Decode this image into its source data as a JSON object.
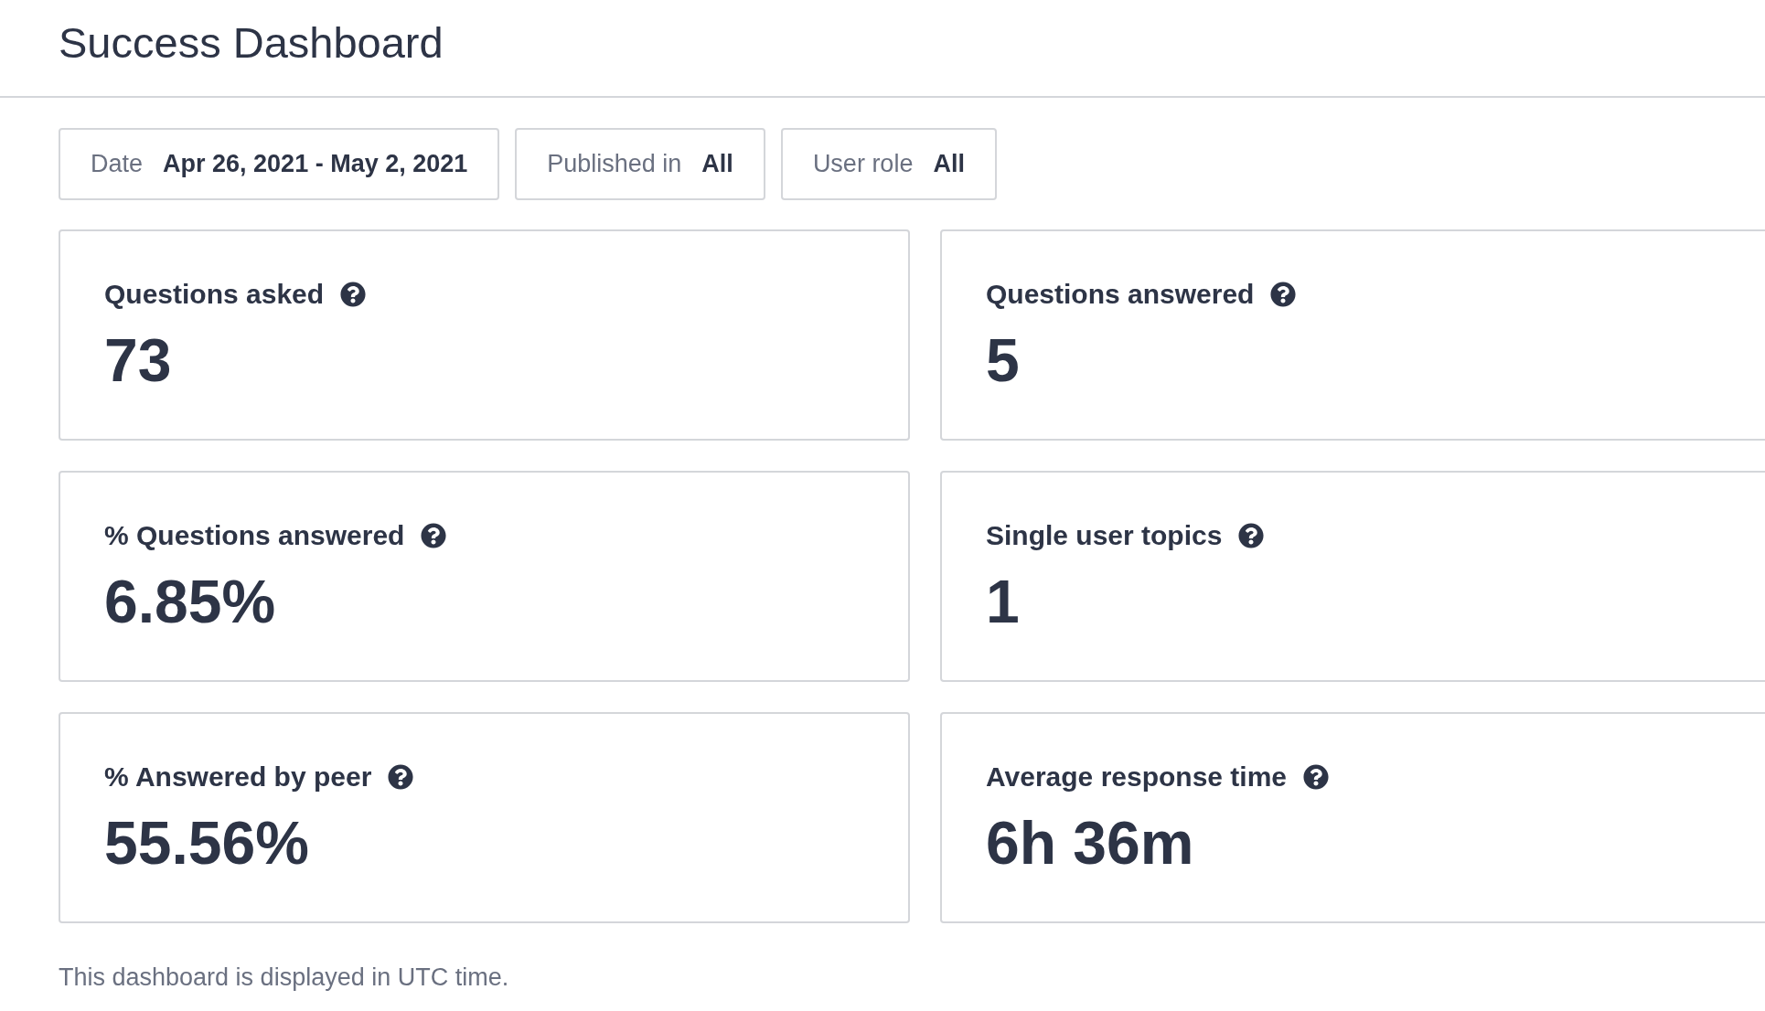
{
  "header": {
    "title": "Success Dashboard"
  },
  "filters": [
    {
      "label": "Date",
      "value": "Apr 26, 2021 - May 2, 2021"
    },
    {
      "label": "Published in",
      "value": "All"
    },
    {
      "label": "User role",
      "value": "All"
    }
  ],
  "metrics": [
    {
      "label": "Questions asked",
      "value": "73"
    },
    {
      "label": "Questions answered",
      "value": "5"
    },
    {
      "label": "% Questions answered",
      "value": "6.85%"
    },
    {
      "label": "Single user topics",
      "value": "1"
    },
    {
      "label": "% Answered by peer",
      "value": "55.56%"
    },
    {
      "label": "Average response time",
      "value": "6h 36m"
    }
  ],
  "footer_note": "This dashboard is displayed in UTC time."
}
